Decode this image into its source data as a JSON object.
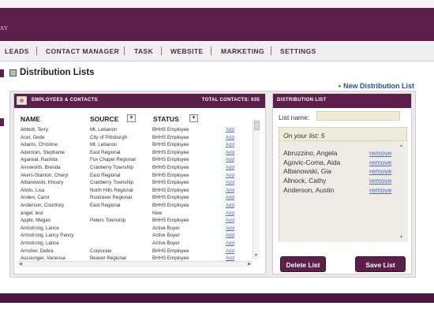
{
  "header": {
    "brand": "AY"
  },
  "nav": {
    "items": [
      "LEADS",
      "CONTACT MANAGER",
      "TASK",
      "WEBSITE",
      "MARKETING",
      "SETTINGS"
    ]
  },
  "page": {
    "title": "Distribution Lists",
    "new_link": "New Distribution List"
  },
  "employees": {
    "title": "EMPLOYEES & CONTACTS",
    "total": "TOTAL CONTACTS: 935",
    "columns": {
      "name": "NAME",
      "source": "SOURCE",
      "status": "STATUS"
    },
    "dropdown_glyph": "▾",
    "add_label": "Add",
    "rows": [
      {
        "name": "Abbott, Terry",
        "source": "Mt. Lebanon",
        "status": "BHHS Employee"
      },
      {
        "name": "Acer, Dede",
        "source": "City of Pittsburgh",
        "status": "BHHS Employee"
      },
      {
        "name": "Adams, Christine",
        "source": "Mt. Lebanon",
        "status": "BHHS Employee"
      },
      {
        "name": "Adeniran, Stephanie",
        "source": "East Regional",
        "status": "BHHS Employee"
      },
      {
        "name": "Agarwal, Rachita",
        "source": "Fox Chapel Regional",
        "status": "BHHS Employee"
      },
      {
        "name": "Ainsworth, Brenda",
        "source": "Cranberry Township",
        "status": "BHHS Employee"
      },
      {
        "name": "Akers-Stanton, Cheryl",
        "source": "East Regional",
        "status": "BHHS Employee"
      },
      {
        "name": "Albanowski, Khoury",
        "source": "Cranberry Township",
        "status": "BHHS Employee"
      },
      {
        "name": "Alioto, Lisa",
        "source": "North Hills Regional",
        "status": "BHHS Employee"
      },
      {
        "name": "Anden, Carol",
        "source": "Rostraver Regional",
        "status": "BHHS Employee"
      },
      {
        "name": "Anderson, Courtney",
        "source": "East Regional",
        "status": "BHHS Employee"
      },
      {
        "name": "angel, test",
        "source": "",
        "status": "New"
      },
      {
        "name": "Apple, Megan",
        "source": "Peters Township",
        "status": "BHHS Employee"
      },
      {
        "name": "Armstrong, Lance",
        "source": "",
        "status": "Active Buyer"
      },
      {
        "name": "Armstrong, Lancy Pancy",
        "source": "",
        "status": "Active Buyer"
      },
      {
        "name": "Armstrong, Lance",
        "source": "",
        "status": "Active Buyer"
      },
      {
        "name": "Arrisher, Debra",
        "source": "Corporate",
        "status": "BHHS Employee"
      },
      {
        "name": "Aucounger, Vanessa",
        "source": "Beaver Regional",
        "status": "BHHS Employee"
      }
    ]
  },
  "distribution": {
    "title": "DISTRIBUTION LIST",
    "list_name_label": "List name:",
    "list_name_value": "",
    "on_list_label": "On your list: 5",
    "remove_label": "remove",
    "members": [
      "Abruzzino, Angela",
      "Agovic-Coma, Aida",
      "Albanowski, Gia",
      "Allnock, Cathy",
      "Anderson, Austin"
    ],
    "delete_button": "Delete List",
    "save_button": "Save List"
  },
  "colors": {
    "brand_purple": "#5b1f4a",
    "link_blue": "#4a6ac8",
    "list_bg": "#efecd9"
  }
}
